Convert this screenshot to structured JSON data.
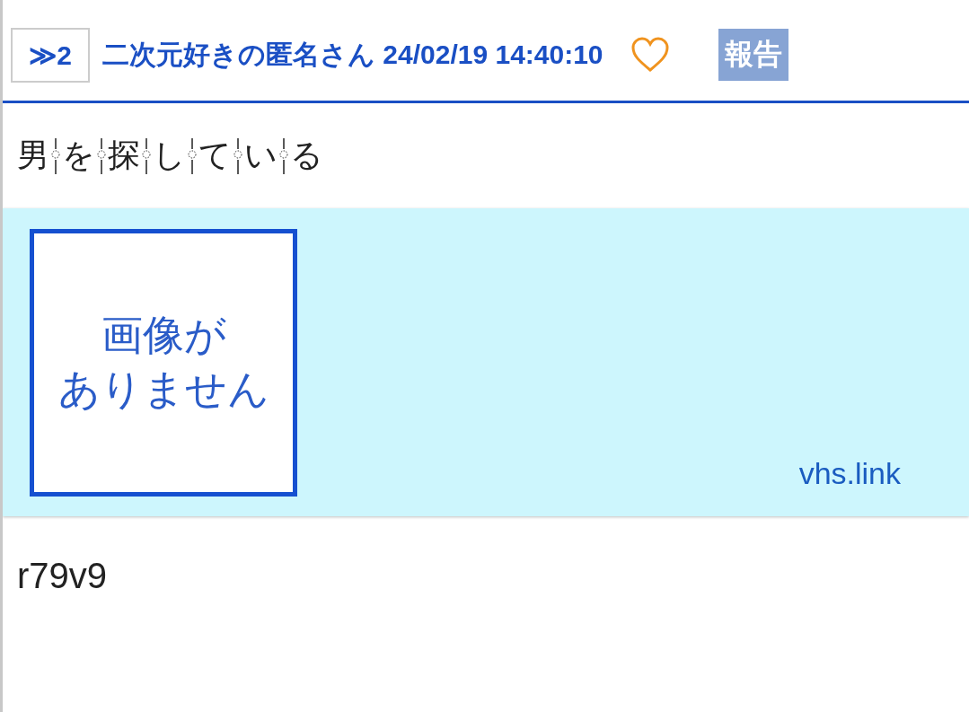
{
  "post": {
    "number_prefix": "≫",
    "number": "2",
    "author": "二次元好きの匿名さん",
    "datetime": "24/02/19 14:40:10",
    "liked": false,
    "report_label": "報告"
  },
  "body_text": "男を探している",
  "link_card": {
    "image_placeholder_lines": [
      "画像が",
      "ありません"
    ],
    "domain": "vhs.link"
  },
  "footer_text": "r79v9"
}
